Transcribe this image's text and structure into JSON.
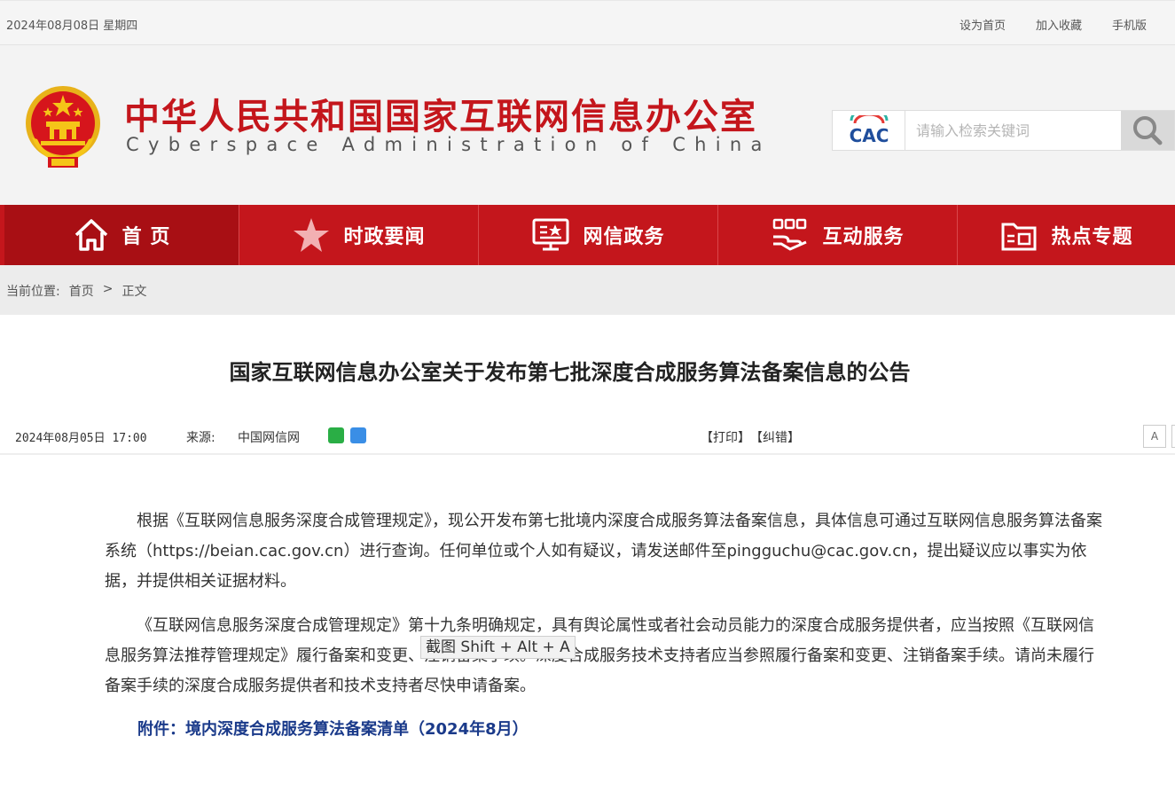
{
  "topbar": {
    "date": "2024年08月08日 星期四",
    "links": [
      "设为首页",
      "加入收藏",
      "手机版"
    ]
  },
  "header": {
    "title": "中华人民共和国国家互联网信息办公室",
    "subtitle": "Cyberspace  Administration  of  China",
    "search_logo": "CAC",
    "search_placeholder": "请输入检索关键词"
  },
  "nav": {
    "items": [
      {
        "label": "首 页",
        "icon": "home-icon"
      },
      {
        "label": "时政要闻",
        "icon": "star-icon"
      },
      {
        "label": "网信政务",
        "icon": "monitor-icon"
      },
      {
        "label": "互动服务",
        "icon": "hands-icon"
      },
      {
        "label": "热点专题",
        "icon": "folder-icon"
      }
    ]
  },
  "breadcrumb": {
    "prefix": "当前位置:",
    "home": "首页",
    "sep": ">",
    "current": "正文"
  },
  "article": {
    "title": "国家互联网信息办公室关于发布第七批深度合成服务算法备案信息的公告",
    "time": "2024年08月05日 17:00",
    "source_label": "来源:",
    "source": "中国网信网",
    "print": "【打印】",
    "correct": "【纠错】",
    "font_button": "A",
    "paragraphs": [
      "根据《互联网信息服务深度合成管理规定》，现公开发布第七批境内深度合成服务算法备案信息，具体信息可通过互联网信息服务算法备案系统（https://beian.cac.gov.cn）进行查询。任何单位或个人如有疑议，请发送邮件至pingguchu@cac.gov.cn，提出疑议应以事实为依据，并提供相关证据材料。",
      "《互联网信息服务深度合成管理规定》第十九条明确规定，具有舆论属性或者社会动员能力的深度合成服务提供者，应当按照《互联网信息服务算法推荐管理规定》履行备案和变更、注销备案手续。深度合成服务技术支持者应当参照履行备案和变更、注销备案手续。请尚未履行备案手续的深度合成服务提供者和技术支持者尽快申请备案。"
    ],
    "attachment": "附件：境内深度合成服务算法备案清单（2024年8月）"
  },
  "tooltip": "截图 Shift + Alt + A",
  "colors": {
    "brand_red": "#c4161c",
    "nav_active": "#a80f14",
    "attachment_blue": "#1a3a8a"
  }
}
